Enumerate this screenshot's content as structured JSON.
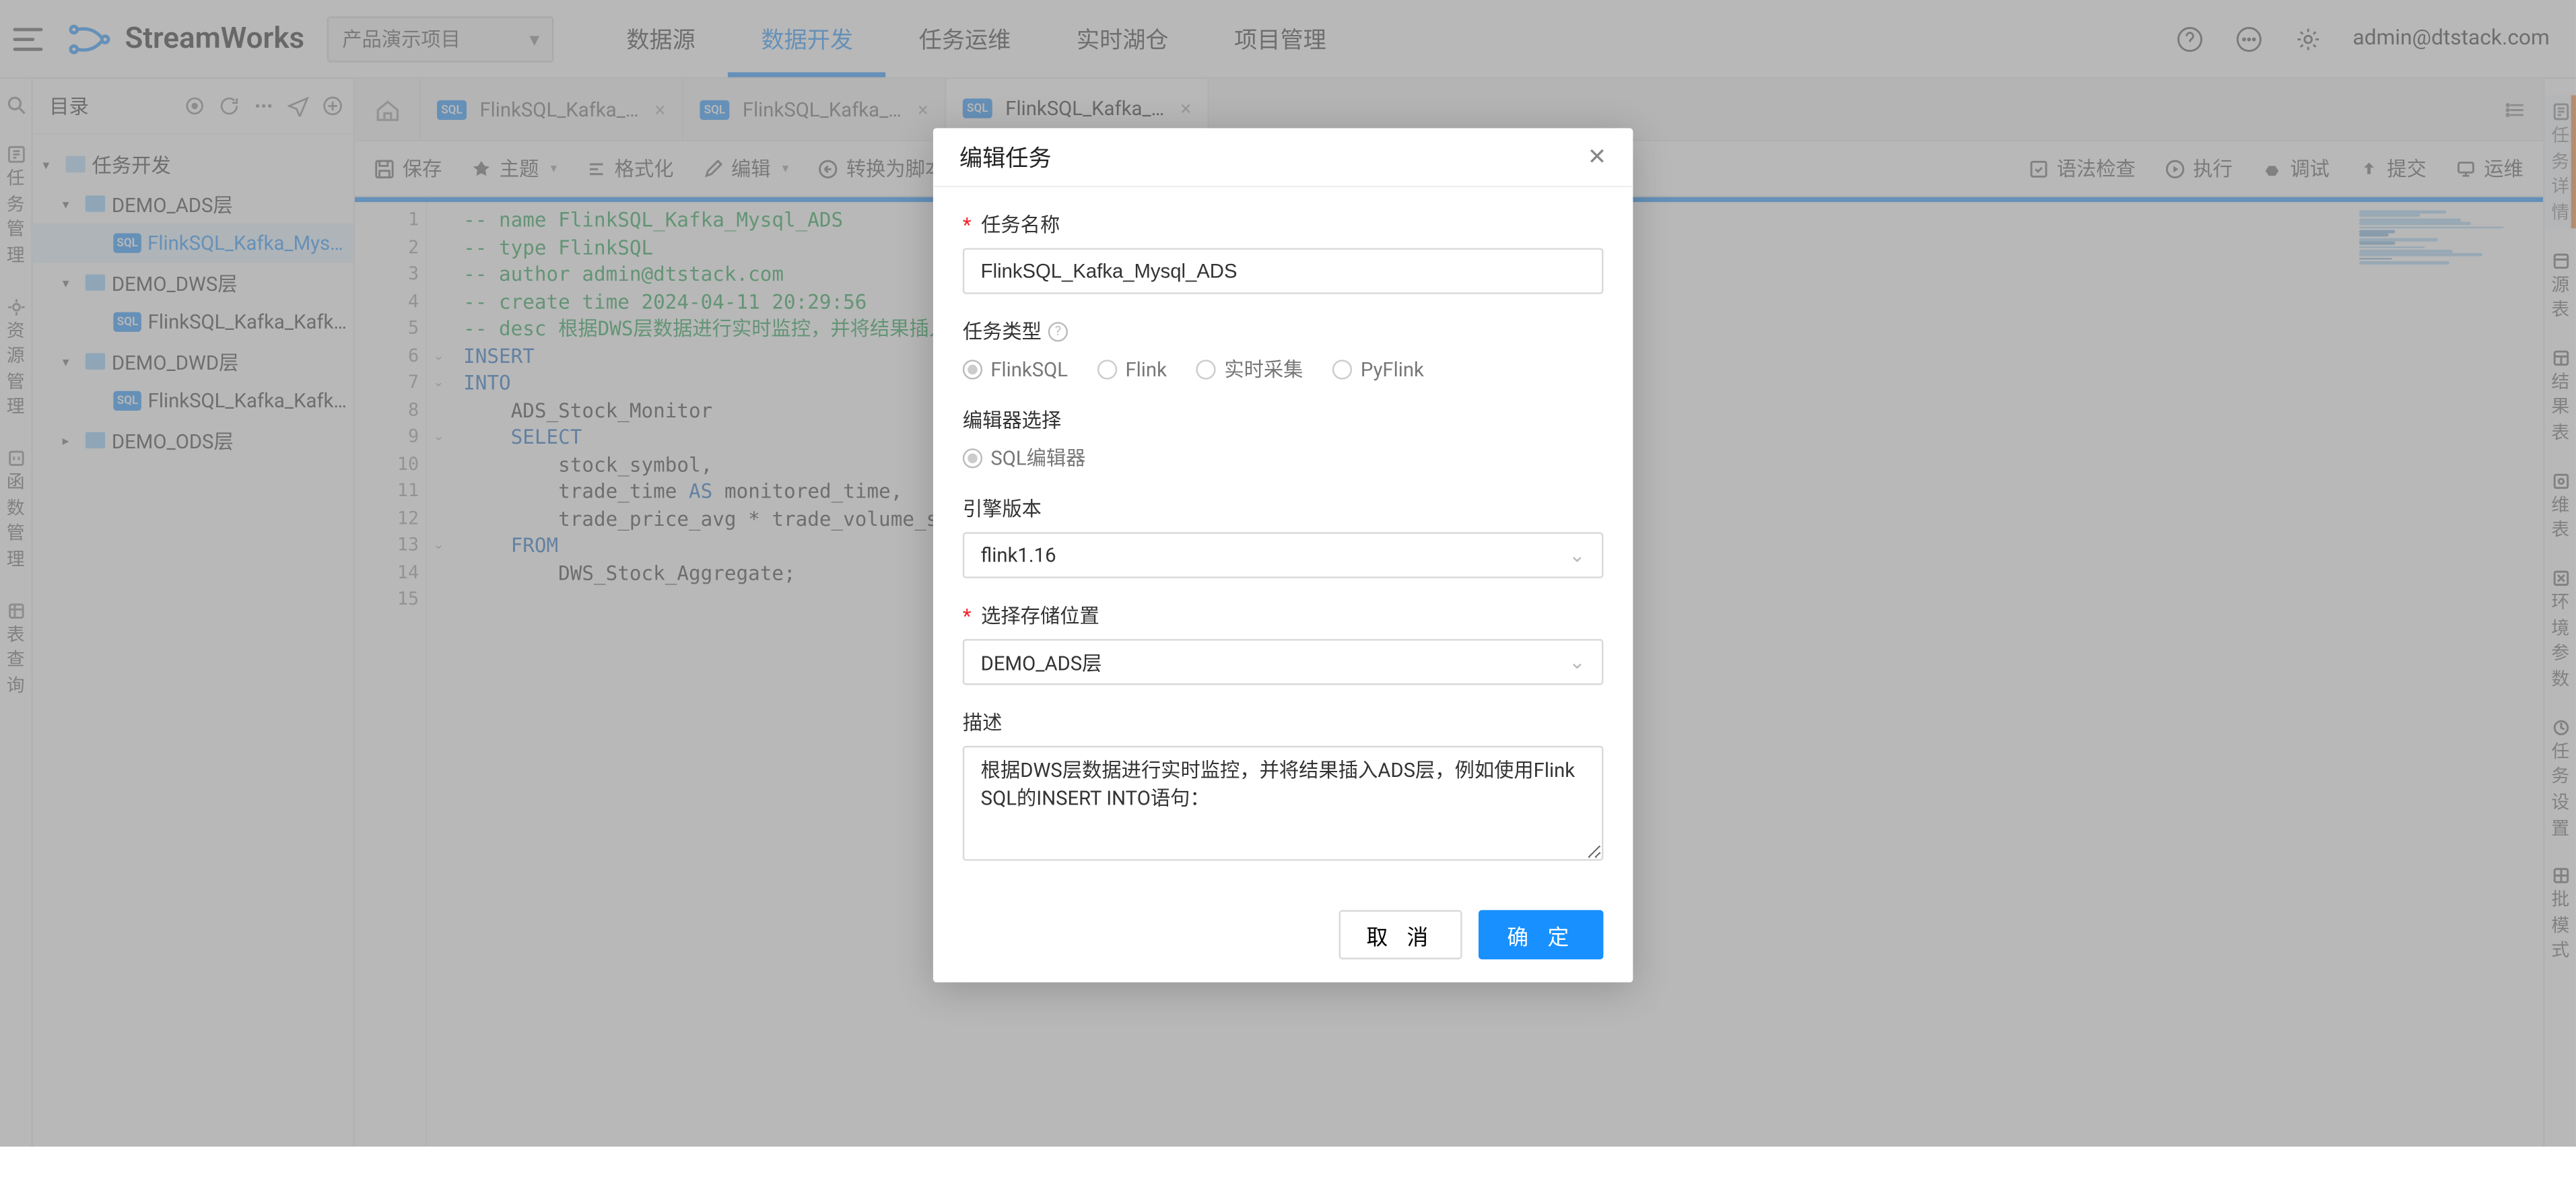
{
  "brand": "StreamWorks",
  "project_selector": {
    "value": "产品演示项目"
  },
  "top_nav": [
    "数据源",
    "数据开发",
    "任务运维",
    "实时湖仓",
    "项目管理"
  ],
  "top_nav_active_index": 1,
  "user_email": "admin@dtstack.com",
  "left_rail": [
    {
      "label": "任务管理"
    },
    {
      "label": "资源管理"
    },
    {
      "label": "函数管理"
    },
    {
      "label": "表查询"
    }
  ],
  "sidebar": {
    "title": "目录",
    "tree": {
      "root": {
        "label": "任务开发"
      },
      "folders": [
        {
          "label": "DEMO_ADS层",
          "children": [
            {
              "label": "FlinkSQL_Kafka_Mysql_...",
              "selected": true
            }
          ]
        },
        {
          "label": "DEMO_DWS层",
          "children": [
            {
              "label": "FlinkSQL_Kafka_Kafka_..."
            }
          ]
        },
        {
          "label": "DEMO_DWD层",
          "children": [
            {
              "label": "FlinkSQL_Kafka_Kafka_..."
            }
          ]
        },
        {
          "label": "DEMO_ODS层"
        }
      ]
    }
  },
  "tabs": [
    {
      "label": "FlinkSQL_Kafka_Ka..."
    },
    {
      "label": "FlinkSQL_Kafka_Ka..."
    },
    {
      "label": "FlinkSQL_Kafka_M...",
      "active": true
    }
  ],
  "toolbar": {
    "save": "保存",
    "theme": "主题",
    "format": "格式化",
    "edit": "编辑",
    "to_script": "转换为脚本",
    "syntax": "语法检查",
    "run": "执行",
    "debug": "调试",
    "submit": "提交",
    "ops": "运维"
  },
  "code_lines": [
    {
      "n": 1,
      "cls": "c-cm",
      "text": "-- name FlinkSQL_Kafka_Mysql_ADS"
    },
    {
      "n": 2,
      "cls": "c-cm",
      "text": "-- type FlinkSQL"
    },
    {
      "n": 3,
      "cls": "c-cm",
      "text": "-- author admin@dtstack.com"
    },
    {
      "n": 4,
      "cls": "c-cm",
      "text": "-- create time 2024-04-11 20:29:56"
    },
    {
      "n": 5,
      "cls": "c-cm",
      "text": "-- desc 根据DWS层数据进行实时监控，并将结果插入ADS层，"
    },
    {
      "n": 6,
      "cls": "c-kw",
      "text": "INSERT",
      "fold": true
    },
    {
      "n": 7,
      "cls": "c-kw",
      "text": "INTO",
      "fold": true
    },
    {
      "n": 8,
      "cls": "",
      "text": "    ADS_Stock_Monitor"
    },
    {
      "n": 9,
      "cls": "",
      "text": "    ",
      "rich": [
        {
          "t": "SELECT",
          "c": "c-kw"
        }
      ],
      "fold": true
    },
    {
      "n": 10,
      "cls": "",
      "text": "        stock_symbol,"
    },
    {
      "n": 11,
      "cls": "",
      "text": "        trade_time ",
      "rich": [
        {
          "t": "AS",
          "c": "c-kw"
        },
        {
          "t": " monitored_time,",
          "c": ""
        }
      ]
    },
    {
      "n": 12,
      "cls": "",
      "text": "        trade_price_avg * trade_volume_sum ",
      "rich": [
        {
          "t": "AS",
          "c": "c-kw"
        },
        {
          "t": " p",
          "c": ""
        }
      ]
    },
    {
      "n": 13,
      "cls": "",
      "text": "    ",
      "rich": [
        {
          "t": "FROM",
          "c": "c-kw"
        }
      ],
      "fold": true
    },
    {
      "n": 14,
      "cls": "",
      "text": "        DWS_Stock_Aggregate;"
    },
    {
      "n": 15,
      "cls": "",
      "text": ""
    }
  ],
  "right_rail": [
    {
      "label": "任务详情",
      "active": true
    },
    {
      "label": "源表"
    },
    {
      "label": "结果表"
    },
    {
      "label": "维表"
    },
    {
      "label": "环境参数"
    },
    {
      "label": "任务设置"
    },
    {
      "label": "批模式"
    }
  ],
  "modal": {
    "title": "编辑任务",
    "fields": {
      "name_label": "任务名称",
      "name_value": "FlinkSQL_Kafka_Mysql_ADS",
      "type_label": "任务类型",
      "type_options": [
        "FlinkSQL",
        "Flink",
        "实时采集",
        "PyFlink"
      ],
      "type_selected": "FlinkSQL",
      "editor_label": "编辑器选择",
      "editor_options": [
        "SQL编辑器"
      ],
      "editor_selected": "SQL编辑器",
      "engine_label": "引擎版本",
      "engine_value": "flink1.16",
      "location_label": "选择存储位置",
      "location_value": "DEMO_ADS层",
      "desc_label": "描述",
      "desc_value": "根据DWS层数据进行实时监控，并将结果插入ADS层，例如使用Flink SQL的INSERT INTO语句："
    },
    "cancel": "取 消",
    "ok": "确 定"
  }
}
